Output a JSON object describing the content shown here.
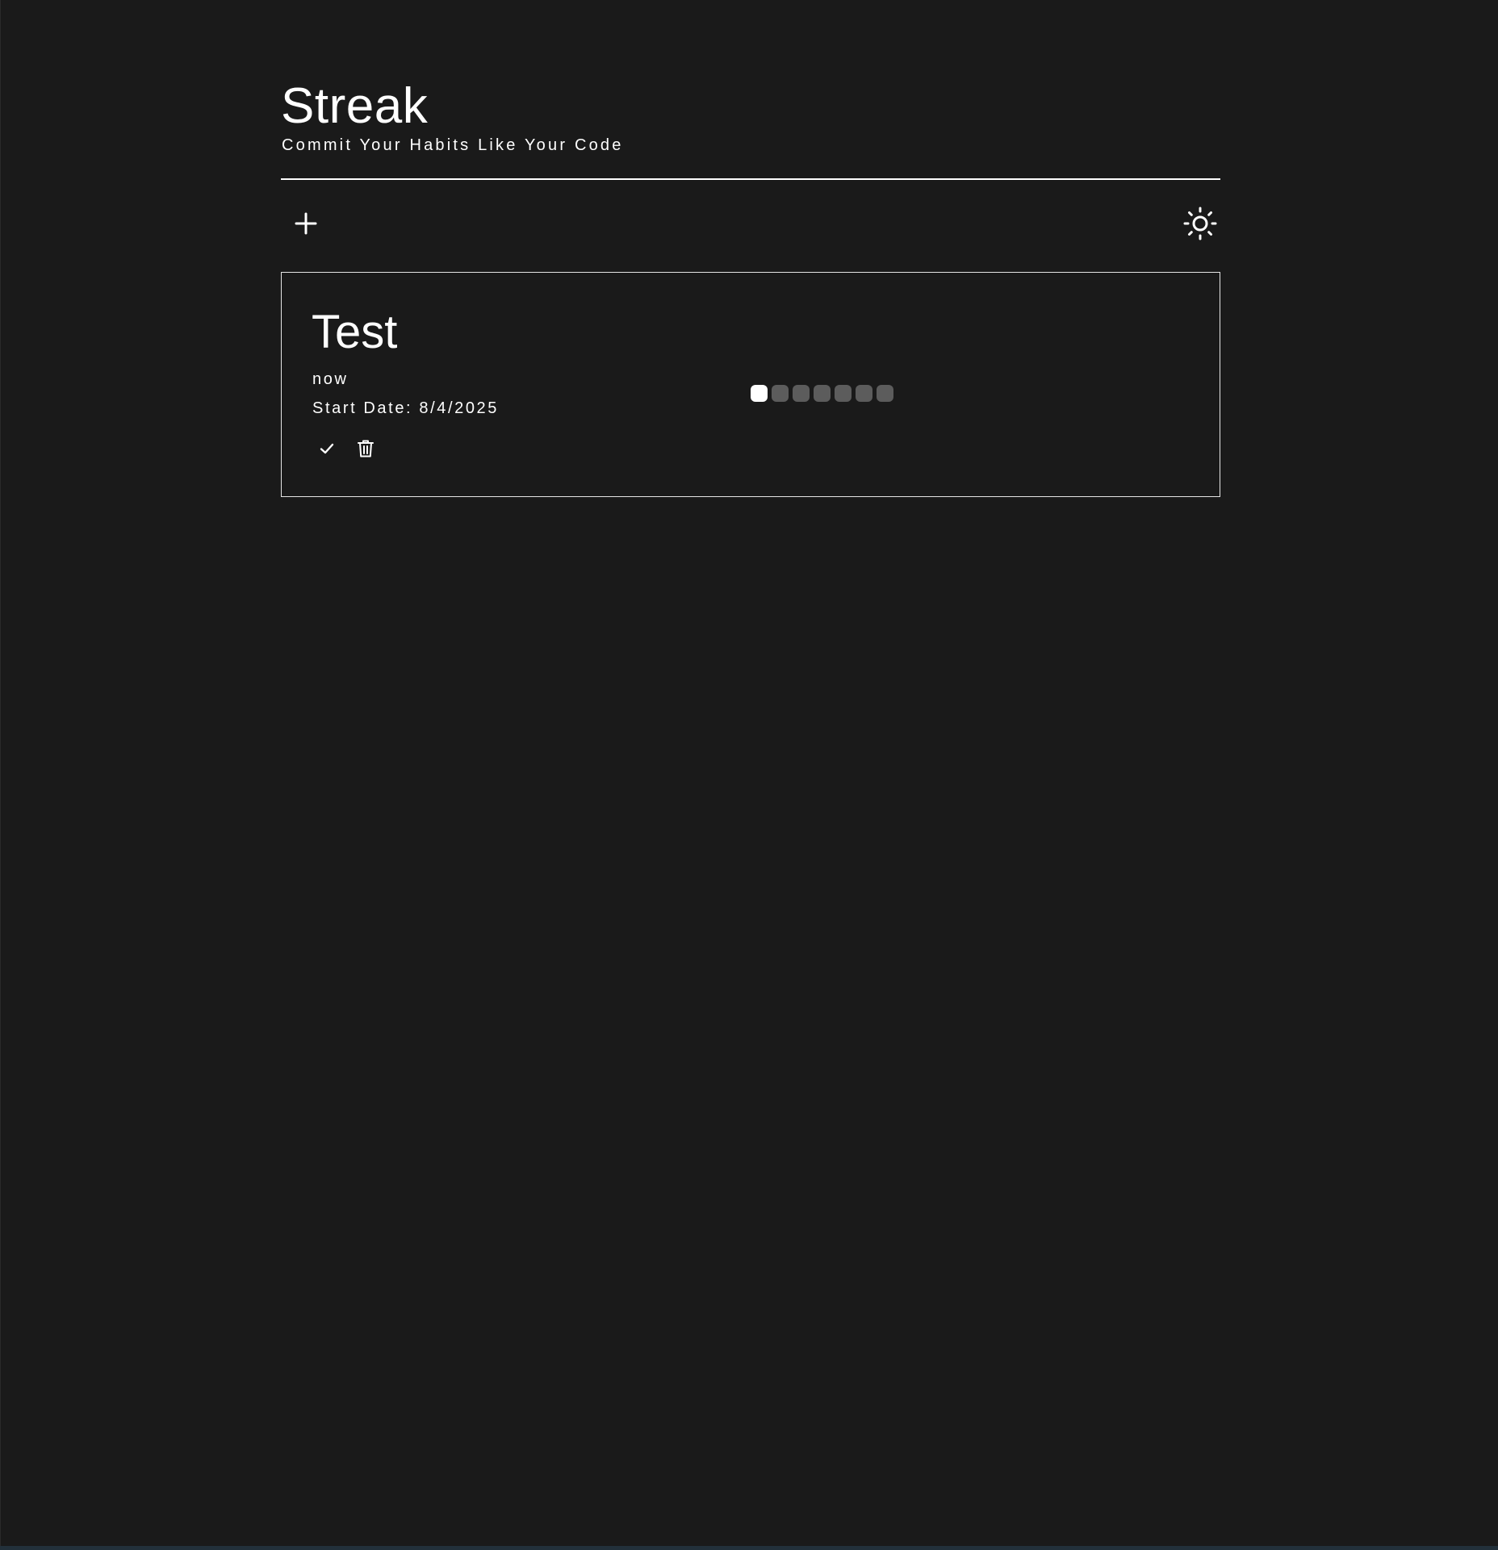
{
  "app": {
    "title": "Streak",
    "tagline": "Commit Your Habits Like Your Code"
  },
  "toolbar": {
    "add_icon": "plus-icon",
    "theme_icon": "sun-icon"
  },
  "habits": [
    {
      "name": "Test",
      "frequency": "now",
      "start_date": "Start Date: 8/4/2025",
      "actions": {
        "complete_icon": "check-icon",
        "delete_icon": "trash-icon"
      },
      "streak": {
        "completed_days": 1,
        "total_days": 7
      }
    }
  ],
  "colors": {
    "background": "#1a1a1a",
    "foreground": "#ffffff",
    "streak_done": "#ffffff",
    "streak_pending": "#5c5c5c"
  }
}
